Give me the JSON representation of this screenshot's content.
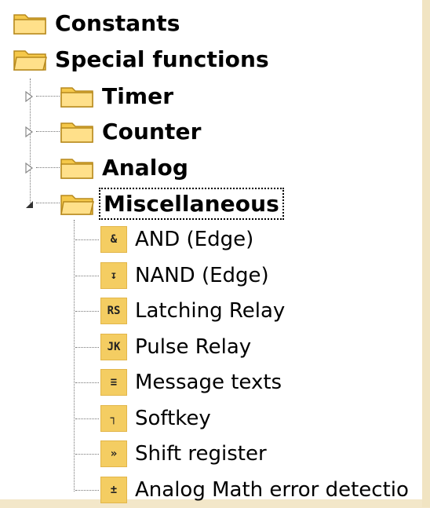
{
  "tree": {
    "root_items": [
      {
        "label": "Constants"
      },
      {
        "label": "Special functions"
      }
    ],
    "special_children": [
      {
        "label": "Timer",
        "expanded": false
      },
      {
        "label": "Counter",
        "expanded": false
      },
      {
        "label": "Analog",
        "expanded": false
      },
      {
        "label": "Miscellaneous",
        "expanded": true,
        "focused": true
      }
    ],
    "misc_children": [
      {
        "label": "AND (Edge)",
        "icon": "&",
        "icon_name": "and-edge-icon"
      },
      {
        "label": "NAND (Edge)",
        "icon": "↧",
        "icon_name": "nand-edge-icon"
      },
      {
        "label": "Latching Relay",
        "icon": "RS",
        "icon_name": "latching-relay-icon"
      },
      {
        "label": "Pulse Relay",
        "icon": "JK",
        "icon_name": "pulse-relay-icon"
      },
      {
        "label": "Message texts",
        "icon": "≡",
        "icon_name": "message-texts-icon"
      },
      {
        "label": "Softkey",
        "icon": "┐",
        "icon_name": "softkey-icon"
      },
      {
        "label": "Shift register",
        "icon": "»",
        "icon_name": "shift-register-icon"
      },
      {
        "label": "Analog Math error detectio",
        "icon": "±",
        "icon_name": "analog-math-error-icon"
      }
    ]
  },
  "colors": {
    "background": "#ffffff",
    "folder": "#f5c84a",
    "icon_bg": "#f4cd62"
  }
}
